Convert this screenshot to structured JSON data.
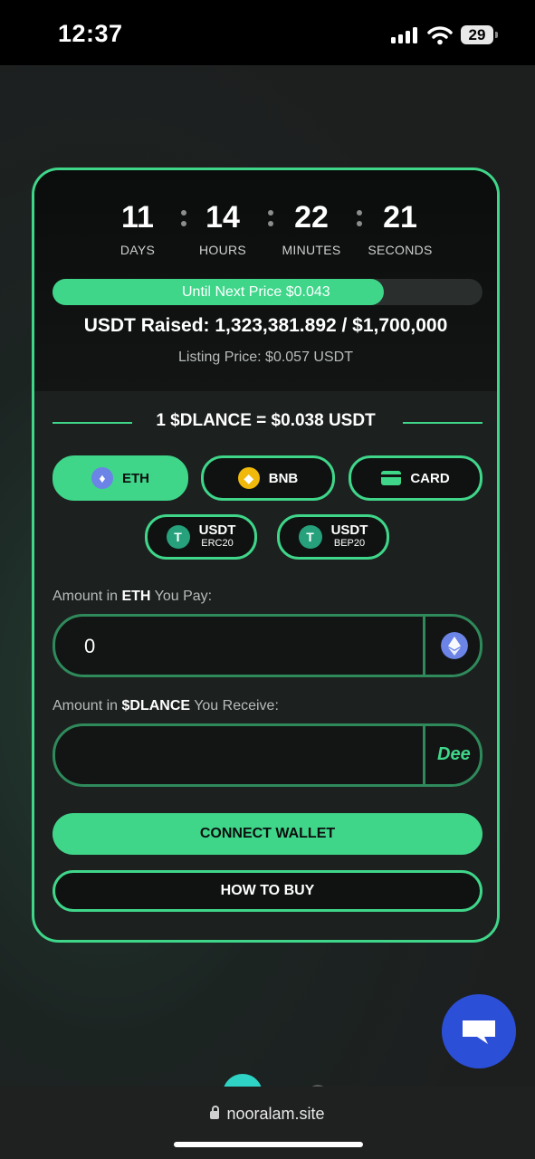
{
  "status_bar": {
    "time": "12:37",
    "battery": "29"
  },
  "countdown": {
    "days": "11",
    "hours": "14",
    "minutes": "22",
    "seconds": "21",
    "days_label": "DAYS",
    "hours_label": "HOURS",
    "minutes_label": "MINUTES",
    "seconds_label": "SECONDS"
  },
  "progress": {
    "label": "Until Next Price $0.043",
    "fraction": 0.77
  },
  "raised_text": "USDT Raised: 1,323,381.892 / $1,700,000",
  "listing_text": "Listing Price: $0.057 USDT",
  "rate_text": "1 $DLANCE = $0.038 USDT",
  "payment_options": {
    "eth": "ETH",
    "bnb": "BNB",
    "card": "CARD",
    "usdt_erc20": {
      "label": "USDT",
      "sub": "ERC20"
    },
    "usdt_bep20": {
      "label": "USDT",
      "sub": "BEP20"
    }
  },
  "pay_field": {
    "label_prefix": "Amount in ",
    "label_token": "ETH",
    "label_suffix": " You Pay:",
    "value": "0"
  },
  "receive_field": {
    "label_prefix": "Amount in ",
    "label_token": "$DLANCE",
    "label_suffix": " You Receive:",
    "value": "",
    "token_logo_text": "Dee"
  },
  "buttons": {
    "connect": "CONNECT WALLET",
    "how_to_buy": "HOW TO BUY"
  },
  "browser": {
    "url": "nooralam.site"
  },
  "colors": {
    "accent": "#3fd68a",
    "chat": "#2c4fd8"
  },
  "icons": [
    "eth-icon",
    "bnb-icon",
    "credit-card-icon",
    "tether-icon",
    "chat-icon",
    "lock-icon"
  ]
}
